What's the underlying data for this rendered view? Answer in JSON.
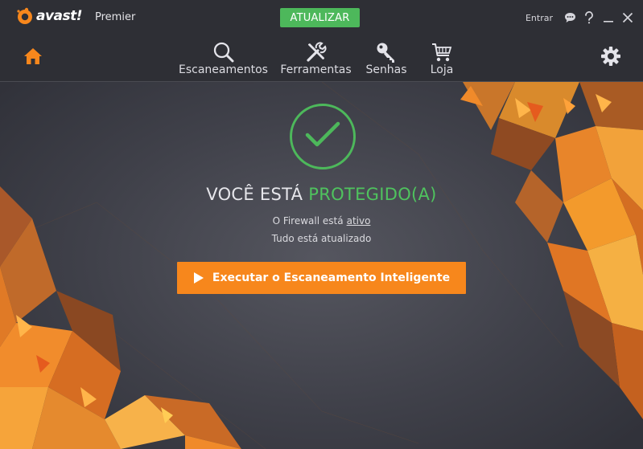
{
  "app": {
    "brand": "avast!",
    "edition": "Premier",
    "update_label": "ATUALIZAR",
    "signin_label": "Entrar",
    "colors": {
      "accent_orange": "#f7871c",
      "accent_green": "#4db85b",
      "bg_dark": "#2e2f35"
    }
  },
  "window_controls": [
    "chat-icon",
    "help-icon",
    "minimize-icon",
    "close-icon"
  ],
  "nav": {
    "home_icon": "home-icon",
    "settings_icon": "gear-icon",
    "items": [
      {
        "label": "Escaneamentos",
        "icon": "magnifier-icon"
      },
      {
        "label": "Ferramentas",
        "icon": "tools-icon"
      },
      {
        "label": "Senhas",
        "icon": "key-icon"
      },
      {
        "label": "Loja",
        "icon": "cart-icon"
      }
    ]
  },
  "status": {
    "icon": "checkmark-icon",
    "prefix": "VOCÊ ESTÁ",
    "state": "PROTEGIDO(A)",
    "firewall_text": "O Firewall está",
    "firewall_state": "ativo",
    "updates_text": "Tudo está atualizado"
  },
  "action": {
    "scan_label": "Executar o Escaneamento Inteligente",
    "icon": "play-icon"
  }
}
